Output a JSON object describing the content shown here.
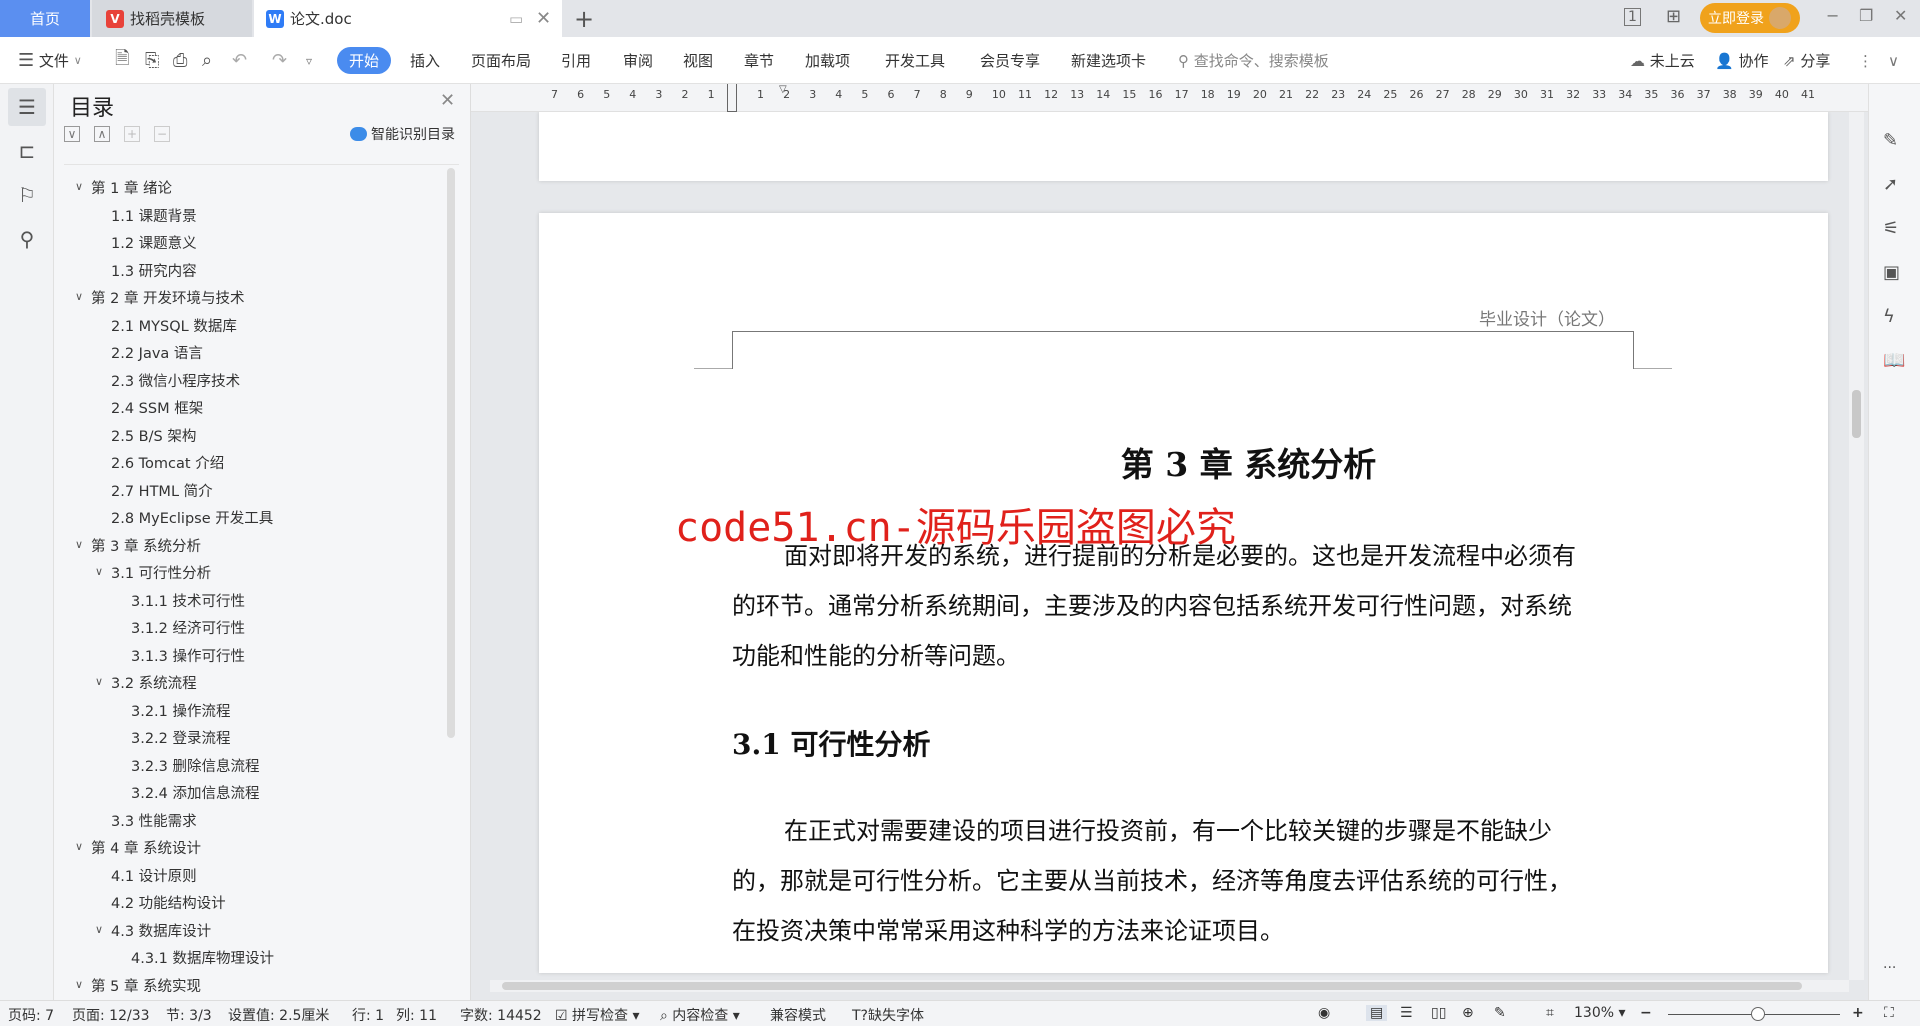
{
  "tabs": {
    "home": "首页",
    "template": "找稻壳模板",
    "doc": "论文.doc",
    "new_tab": "+"
  },
  "titlebar": {
    "login": "立即登录",
    "minimize": "−",
    "restore": "❐",
    "close": "✕"
  },
  "toolbar": {
    "file": "文件",
    "menus": [
      "开始",
      "插入",
      "页面布局",
      "引用",
      "审阅",
      "视图",
      "章节",
      "加载项",
      "开发工具",
      "会员专享",
      "新建选项卡"
    ],
    "search_placeholder": "查找命令、搜索模板",
    "cloud": "未上云",
    "collab": "协作",
    "share": "分享"
  },
  "toc": {
    "title": "目录",
    "smart": "智能识别目录",
    "items": [
      {
        "label": "第 1 章  绪论",
        "level": 1,
        "expand": true
      },
      {
        "label": "1.1  课题背景",
        "level": 2
      },
      {
        "label": "1.2  课题意义",
        "level": 2
      },
      {
        "label": "1.3  研究内容",
        "level": 2
      },
      {
        "label": "第 2 章  开发环境与技术",
        "level": 1,
        "expand": true
      },
      {
        "label": "2.1 MYSQL 数据库",
        "level": 2
      },
      {
        "label": "2.2 Java 语言",
        "level": 2
      },
      {
        "label": "2.3  微信小程序技术",
        "level": 2
      },
      {
        "label": "2.4 SSM 框架",
        "level": 2
      },
      {
        "label": "2.5 B/S 架构",
        "level": 2
      },
      {
        "label": "2.6 Tomcat  介绍",
        "level": 2
      },
      {
        "label": "2.7 HTML 简介",
        "level": 2
      },
      {
        "label": "2.8 MyEclipse 开发工具",
        "level": 2
      },
      {
        "label": "第 3 章  系统分析",
        "level": 1,
        "expand": true
      },
      {
        "label": "3.1  可行性分析",
        "level": 2,
        "expand": true
      },
      {
        "label": "3.1.1  技术可行性",
        "level": 3
      },
      {
        "label": "3.1.2  经济可行性",
        "level": 3
      },
      {
        "label": "3.1.3  操作可行性",
        "level": 3
      },
      {
        "label": "3.2  系统流程",
        "level": 2,
        "expand": true
      },
      {
        "label": "3.2.1  操作流程",
        "level": 3
      },
      {
        "label": "3.2.2  登录流程",
        "level": 3
      },
      {
        "label": "3.2.3  删除信息流程",
        "level": 3
      },
      {
        "label": "3.2.4  添加信息流程",
        "level": 3
      },
      {
        "label": "3.3  性能需求",
        "level": 2
      },
      {
        "label": "第 4 章  系统设计",
        "level": 1,
        "expand": true
      },
      {
        "label": "4.1  设计原则",
        "level": 2
      },
      {
        "label": "4.2  功能结构设计",
        "level": 2
      },
      {
        "label": "4.3  数据库设计",
        "level": 2,
        "expand": true
      },
      {
        "label": "4.3.1  数据库物理设计",
        "level": 3
      },
      {
        "label": "第 5 章  系统实现",
        "level": 1,
        "expand": true
      }
    ]
  },
  "ruler": {
    "left": [
      "7",
      "6",
      "5",
      "4",
      "3",
      "2",
      "1"
    ],
    "right": [
      "1",
      "2",
      "3",
      "4",
      "5",
      "6",
      "7",
      "8",
      "9",
      "10",
      "11",
      "12",
      "13",
      "14",
      "15",
      "16",
      "17",
      "18",
      "19",
      "20",
      "21",
      "22",
      "23",
      "24",
      "25",
      "26",
      "27",
      "28",
      "29",
      "30",
      "31",
      "32",
      "33",
      "34",
      "35",
      "36",
      "37",
      "38",
      "39",
      "40",
      "41"
    ]
  },
  "document": {
    "header": "毕业设计（论文）",
    "chapter_title": "第 3 章  系统分析",
    "watermark": "code51.cn-源码乐园盗图必究",
    "para1": [
      "面对即将开发的系统，进行提前的分析是必要的。这也是开发流程中必须有",
      "的环节。通常分析系统期间，主要涉及的内容包括系统开发可行性问题，对系统",
      "功能和性能的分析等问题。"
    ],
    "section_title": "3.1  可行性分析",
    "para2": [
      "在正式对需要建设的项目进行投资前，有一个比较关键的步骤是不能缺少",
      "的，那就是可行性分析。它主要从当前技术，经济等角度去评估系统的可行性，",
      "在投资决策中常常采用这种科学的方法来论证项目。"
    ]
  },
  "status": {
    "page_no": "页码: 7",
    "pages": "页面: 12/33",
    "section": "节: 3/3",
    "setting": "设置值: 2.5厘米",
    "row": "行: 1",
    "col": "列: 11",
    "words": "字数: 14452",
    "spell": "拼写检查",
    "content_check": "内容检查",
    "compat": "兼容模式",
    "missing_font": "缺失字体",
    "zoom": "130%"
  },
  "colors": {
    "accent": "#4a8bf0",
    "login": "#f0a21c",
    "watermark": "#e0211b"
  },
  "zoom_slider_percent": 130
}
